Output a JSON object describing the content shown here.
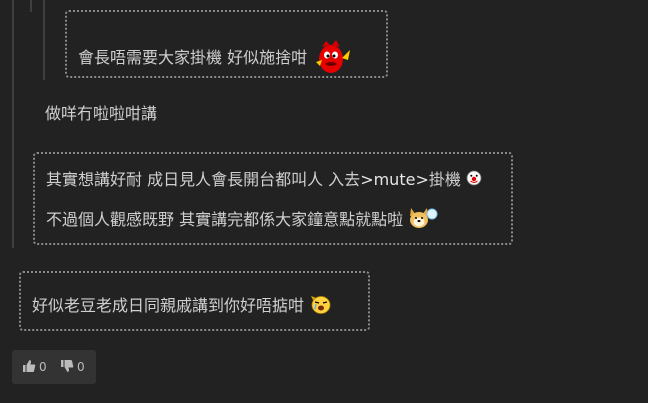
{
  "thread": {
    "quote_inner": {
      "text": "會長唔需要大家掛機 好似施捨咁",
      "emoji": "angry-red-devil-emoji"
    },
    "reply_mid": {
      "text": "做咩冇啦啦咁講"
    },
    "quote_outer": {
      "line1_text": "其實想講好耐 成日見人會長開台都叫人 入去",
      "line1_cmd": ">mute>",
      "line1_tail": "掛機",
      "line1_emoji": "clown-face-emoji",
      "line2_text": "不過個人觀感既野 其實講完都係大家鐘意點就點啦",
      "line2_emoji": "dog-blowing-bubble-emoji"
    },
    "quote_top": {
      "text": "好似老豆老成日同親戚講到你好唔掂咁",
      "emoji": "crying-yellow-face-emoji"
    }
  },
  "votes": {
    "up_icon": "thumbs-up-icon",
    "up_count": "0",
    "down_icon": "thumbs-down-icon",
    "down_count": "0"
  },
  "colors": {
    "background": "#222222",
    "text": "#cfcfcf",
    "quote_border": "#8a8a8a",
    "thread_line": "#3f3f3f",
    "vote_bg": "#333333"
  }
}
